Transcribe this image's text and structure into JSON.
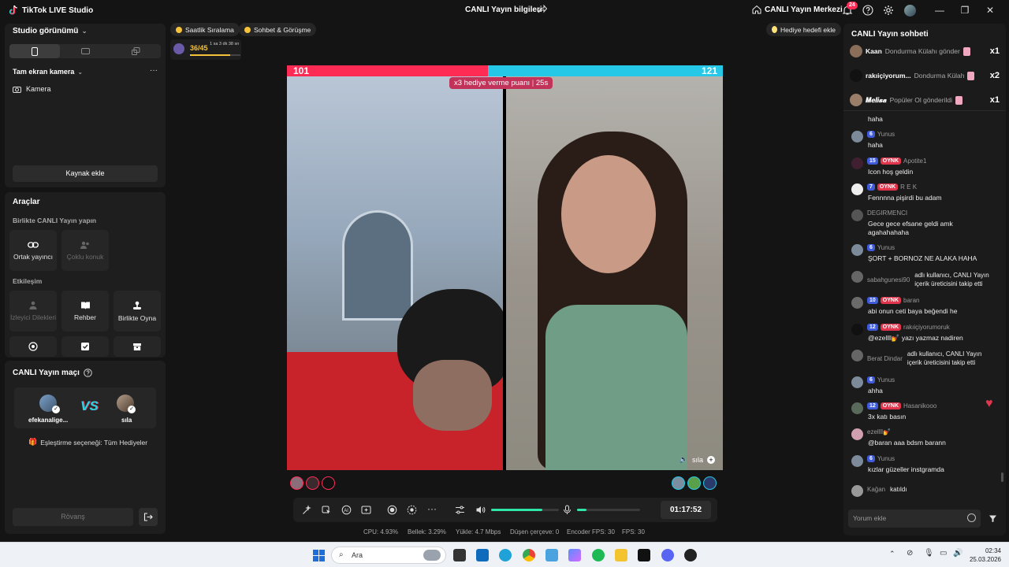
{
  "titlebar": {
    "app_title": "TikTok LIVE Studio",
    "center_title": "CANLI Yayın bilgileri",
    "center_link": "CANLI Yayın Merkezi",
    "notification_count": "24"
  },
  "left_panel": {
    "studio_view_label": "Studio görünümü",
    "scene_label": "Tam ekran kamera",
    "source_camera": "Kamera",
    "add_source": "Kaynak ekle"
  },
  "tools_panel": {
    "title": "Araçlar",
    "section_collab": "Birlikte CANLI Yayın yapın",
    "cohost": "Ortak yayıncı",
    "multi_guest": "Çoklu konuk",
    "section_interaction": "Etkileşim",
    "viewer_requests": "İzleyici Dilekleri",
    "guide": "Rehber",
    "play_together": "Birlikte Oyna"
  },
  "match_panel": {
    "title": "CANLI Yayın maçı",
    "player1": "efekanalige...",
    "player2": "sıla",
    "vs": "VS",
    "matching_option": "Eşleştirme seçeneği: Tüm Hediyeler",
    "rematch": "Rövanş"
  },
  "top_pills": {
    "hourly_ranking": "Saatlik Sıralama",
    "chat_meet": "Sohbet & Görüşme",
    "gift_goal": "Hediye hedefi ekle",
    "progress_value": "36/45",
    "progress_sub": "1 sa 3 dk 38 sn",
    "progress_fraction": 0.8
  },
  "battle": {
    "score_left": "101",
    "score_right": "121",
    "multiplier_text": "x3 hediye verme puanı",
    "multiplier_time": "25s",
    "right_name": "sıla"
  },
  "controls": {
    "timer": "01:17:52",
    "volume_fraction": 0.75,
    "mic_fraction": 0.15
  },
  "stats": {
    "cpu": "CPU:  4.93%",
    "memory": "Bellek:  3.29%",
    "upload": "Yükle:  4.7 Mbps",
    "dropped": "Düşen çerçeve:  0",
    "encoder_fps": "Encoder FPS:  30",
    "fps": "FPS:  30"
  },
  "chat": {
    "title": "CANLI Yayın sohbeti",
    "gifts": [
      {
        "name": "Kaan",
        "text": "Dondurma Külahı gönder",
        "count": "x1"
      },
      {
        "name": "rakıiçiyorum...",
        "text": "Dondurma Külah",
        "count": "x2"
      },
      {
        "name": "𝑴𝒆𝒍𝒊𝒔𝒂",
        "text": "Popüler Ol gönderildi",
        "count": "x1"
      }
    ],
    "messages": [
      {
        "level": "",
        "oynk": "",
        "user": "",
        "text": "haha"
      },
      {
        "level": "6",
        "oynk": "",
        "user": "Yunus",
        "text": "haha"
      },
      {
        "level": "15",
        "oynk": "OYNK",
        "user": "Apotite1",
        "text": "Icon hoş geldin"
      },
      {
        "level": "7",
        "oynk": "OYNK",
        "user": "R E K",
        "text": "Fennnna pişirdi bu adam"
      },
      {
        "level": "",
        "oynk": "",
        "user": "DEGIRMENCI",
        "text": "Gece gece efsane geldi amk agahahahaha"
      },
      {
        "level": "6",
        "oynk": "",
        "user": "Yunus",
        "text": "ŞORT + BORNOZ NE ALAKA HAHA"
      },
      {
        "level": "",
        "oynk": "",
        "user": "sabahgunesi90",
        "text": "adlı kullanıcı, CANLI Yayın içerik üreticisini takip etti"
      },
      {
        "level": "10",
        "oynk": "OYNK",
        "user": "baran",
        "text": "abi onun ceti baya beğendi he"
      },
      {
        "level": "12",
        "oynk": "OYNK",
        "user": "rakıiçiyorumoruk",
        "text": "@ezellll💅 yazı yazmaz nadiren"
      },
      {
        "level": "",
        "oynk": "",
        "user": "Berat Dindar",
        "text": "adlı kullanıcı, CANLI Yayın içerik üreticisini takip etti"
      },
      {
        "level": "6",
        "oynk": "",
        "user": "Yunus",
        "text": "ahha"
      },
      {
        "level": "12",
        "oynk": "OYNK",
        "user": "Hasanikooo",
        "text": "3x katı basın"
      },
      {
        "level": "",
        "oynk": "",
        "user": "ezellll💅",
        "text": "@baran aaa bdsm barann"
      },
      {
        "level": "6",
        "oynk": "",
        "user": "Yunus",
        "text": "kızlar güzeller instgramda"
      },
      {
        "level": "",
        "oynk": "",
        "user": "Kağan",
        "text": "katıldı"
      }
    ],
    "comment_placeholder": "Yorum ekle"
  },
  "taskbar": {
    "search_placeholder": "Ara",
    "time": "02:34",
    "date": "25.03.2026"
  },
  "colors": {
    "tiktok_pink": "#fe2c55",
    "tiktok_cyan": "#25c8e6",
    "accent_green": "#2ee6a8"
  }
}
